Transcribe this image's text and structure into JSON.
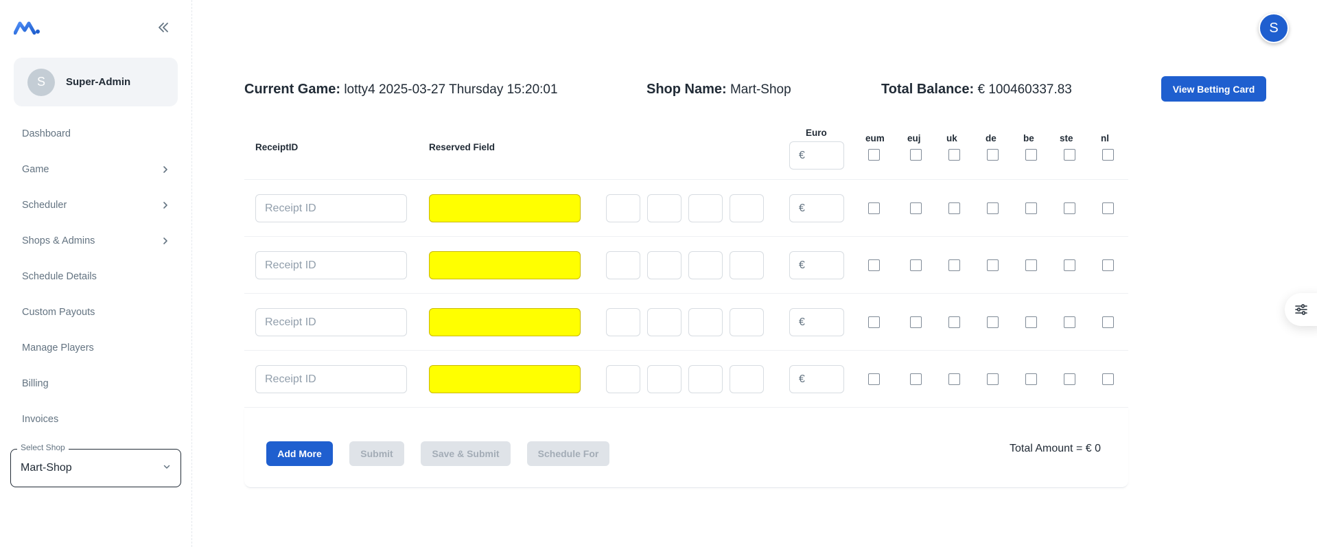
{
  "sidebar": {
    "user": {
      "initial": "S",
      "name": "Super-Admin"
    },
    "items": [
      {
        "label": "Dashboard",
        "has_children": false
      },
      {
        "label": "Game",
        "has_children": true
      },
      {
        "label": "Scheduler",
        "has_children": true
      },
      {
        "label": "Shops & Admins",
        "has_children": true
      },
      {
        "label": "Schedule Details",
        "has_children": false
      },
      {
        "label": "Custom Payouts",
        "has_children": false
      },
      {
        "label": "Manage Players",
        "has_children": false
      },
      {
        "label": "Billing",
        "has_children": false
      },
      {
        "label": "Invoices",
        "has_children": false
      }
    ],
    "select_shop": {
      "label": "Select Shop",
      "value": "Mart-Shop"
    }
  },
  "topbar": {
    "avatar_initial": "S"
  },
  "header": {
    "current_game_label": "Current Game:",
    "current_game_value": "lotty4 2025-03-27 Thursday 15:20:01",
    "shop_name_label": "Shop Name:",
    "shop_name_value": "Mart-Shop",
    "total_balance_label": "Total Balance:",
    "total_balance_value": "€ 100460337.83",
    "view_button": "View Betting Card"
  },
  "table": {
    "headers": {
      "receipt_id": "ReceiptID",
      "reserved_field": "Reserved Field",
      "euro": "Euro",
      "euro_symbol": "€",
      "markets": [
        "eum",
        "euj",
        "uk",
        "de",
        "be",
        "ste",
        "nl"
      ]
    },
    "rows": [
      {
        "receipt_placeholder": "Receipt ID",
        "euro_symbol": "€"
      },
      {
        "receipt_placeholder": "Receipt ID",
        "euro_symbol": "€"
      },
      {
        "receipt_placeholder": "Receipt ID",
        "euro_symbol": "€"
      },
      {
        "receipt_placeholder": "Receipt ID",
        "euro_symbol": "€"
      }
    ]
  },
  "footer": {
    "add_more": "Add More",
    "submit": "Submit",
    "save_submit": "Save & Submit",
    "schedule_for": "Schedule For",
    "total_amount": "Total Amount = € 0"
  },
  "colors": {
    "primary": "#1f5fcf",
    "yellow_field": "#ffff00",
    "disabled": "#dfe3e8"
  },
  "icons": [
    "logo-icon",
    "collapse-icon",
    "chevron-right-icon",
    "chevron-down-icon",
    "settings-sliders-icon"
  ]
}
